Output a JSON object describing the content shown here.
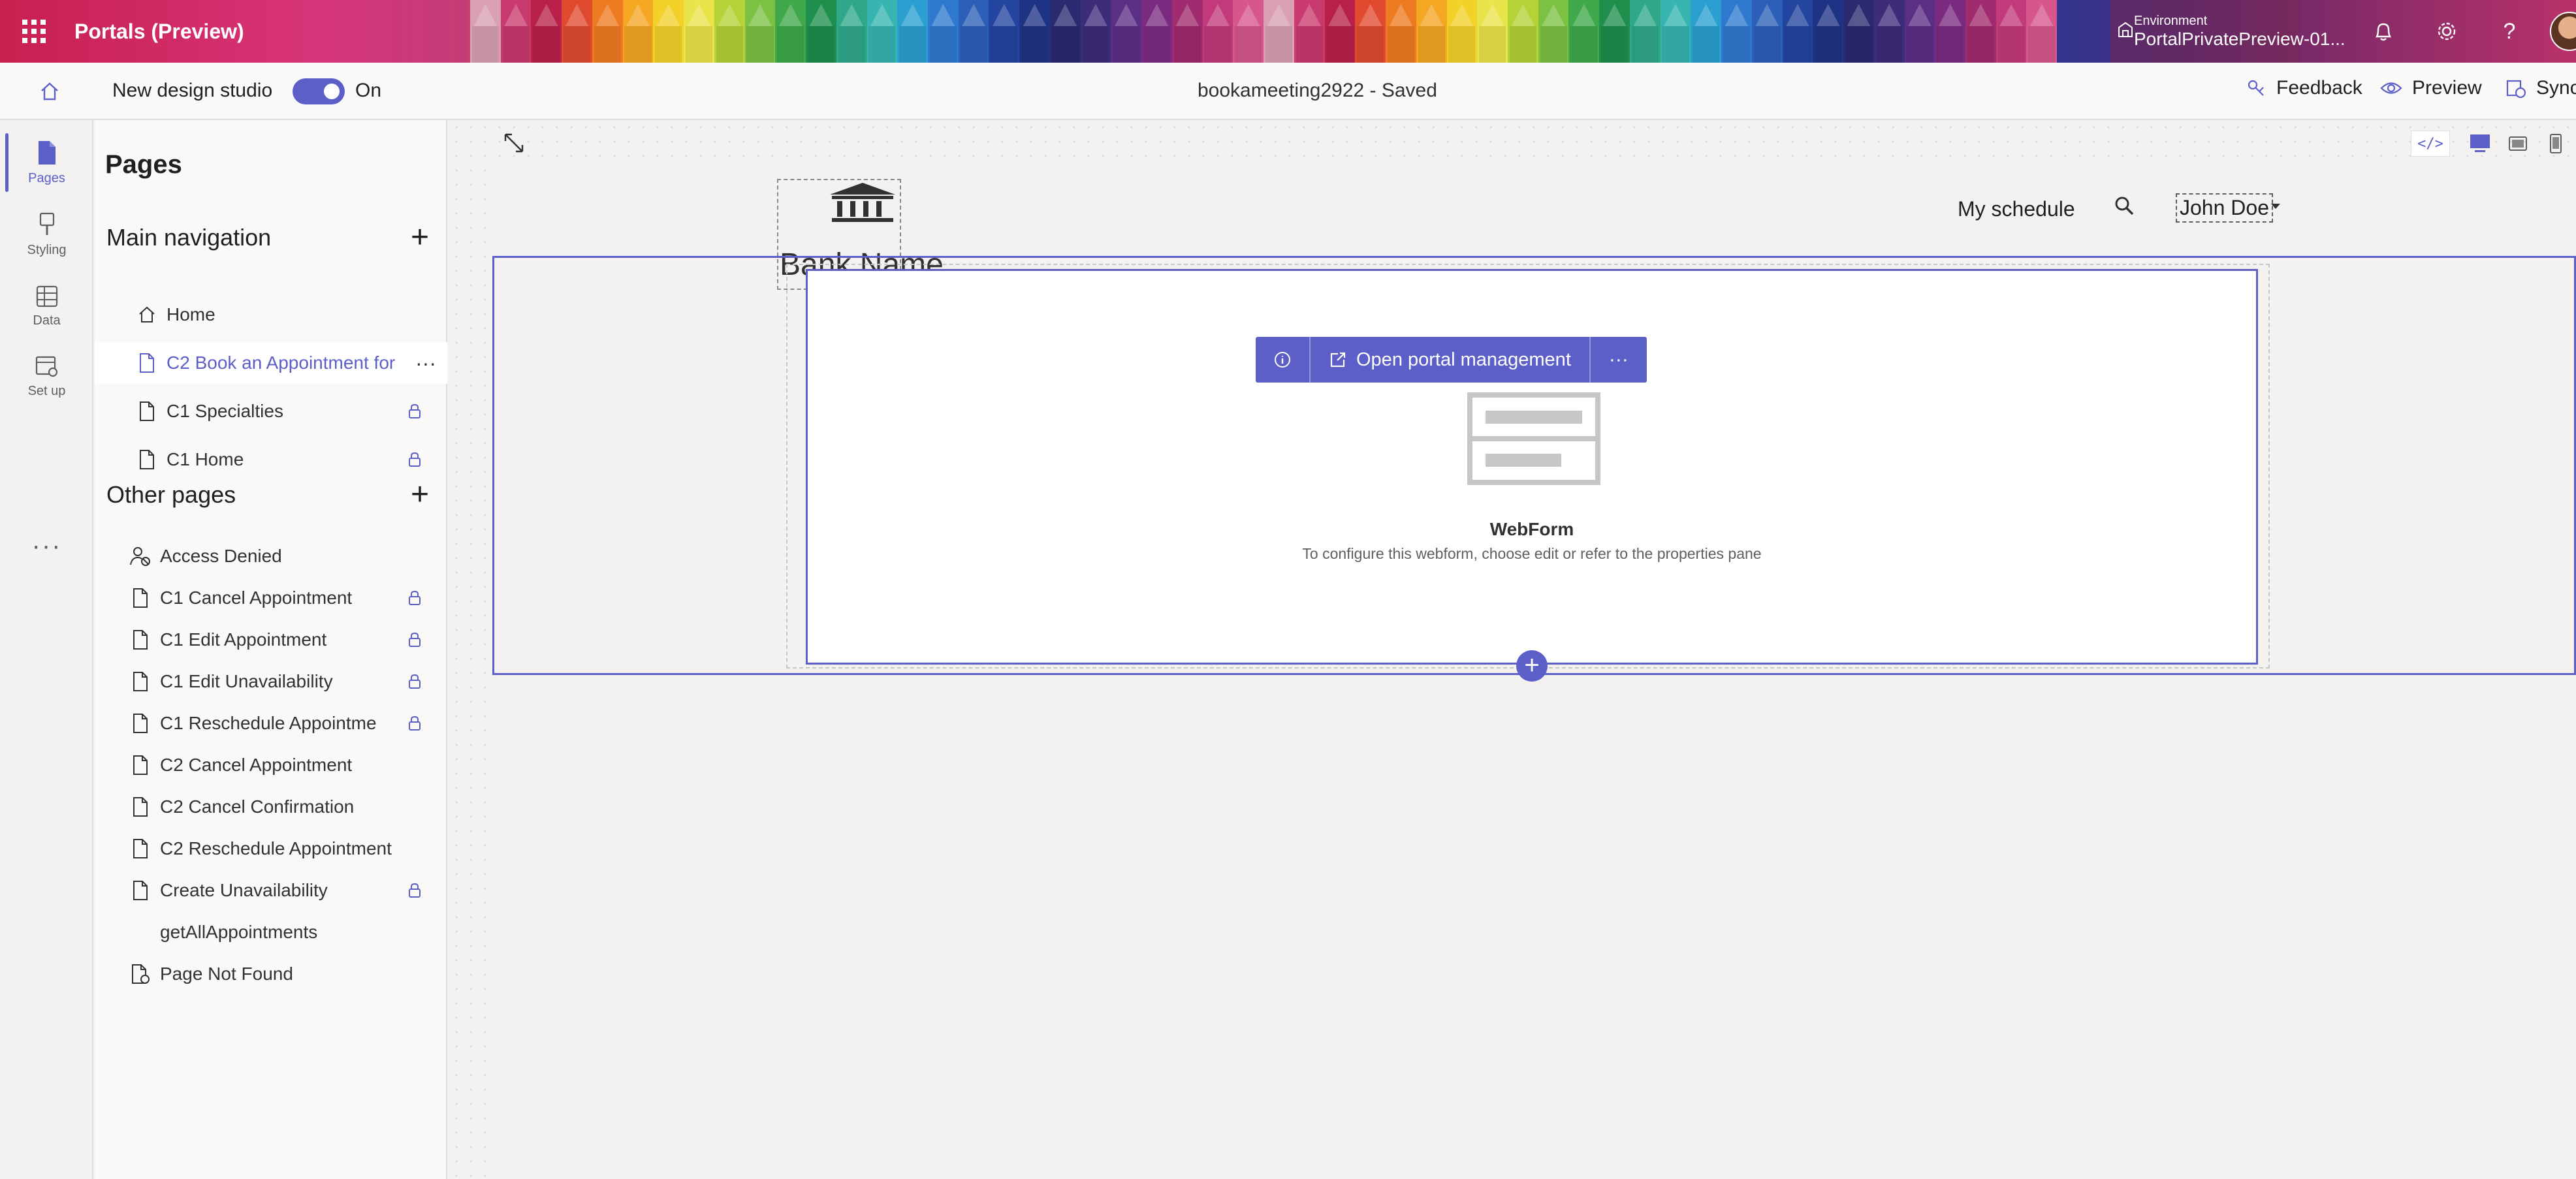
{
  "app": {
    "title": "Portals (Preview)"
  },
  "environment": {
    "label": "Environment",
    "name": "PortalPrivatePreview-01..."
  },
  "commandbar": {
    "design_studio_label": "New design studio",
    "toggle_state": "On",
    "site_title": "bookameeting2922 - Saved",
    "feedback_label": "Feedback",
    "preview_label": "Preview",
    "sync_label": "Sync"
  },
  "rail": {
    "pages": "Pages",
    "styling": "Styling",
    "data": "Data",
    "setup": "Set up",
    "more": "···"
  },
  "panel": {
    "title": "Pages",
    "main_nav_heading": "Main navigation",
    "other_pages_heading": "Other pages",
    "main_items": [
      {
        "label": "Home",
        "icon": "home-icon",
        "locked": false
      },
      {
        "label": "C2 Book an Appointment for",
        "icon": "page-icon",
        "locked": false,
        "selected": true
      },
      {
        "label": "C1 Specialties",
        "icon": "page-icon",
        "locked": true
      },
      {
        "label": "C1 Home",
        "icon": "page-icon",
        "locked": true
      }
    ],
    "other_items": [
      {
        "label": "Access Denied",
        "icon": "person-lock-icon",
        "locked": false
      },
      {
        "label": "C1 Cancel Appointment",
        "icon": "page-icon",
        "locked": true
      },
      {
        "label": "C1 Edit Appointment",
        "icon": "page-icon",
        "locked": true
      },
      {
        "label": "C1 Edit Unavailability",
        "icon": "page-icon",
        "locked": true
      },
      {
        "label": "C1 Reschedule Appointme",
        "icon": "page-icon",
        "locked": true
      },
      {
        "label": "C2 Cancel Appointment",
        "icon": "page-icon",
        "locked": false
      },
      {
        "label": "C2 Cancel Confirmation",
        "icon": "page-icon",
        "locked": false
      },
      {
        "label": "C2 Reschedule Appointment",
        "icon": "page-icon",
        "locked": false
      },
      {
        "label": "Create Unavailability",
        "icon": "page-icon",
        "locked": true
      },
      {
        "label": "getAllAppointments",
        "icon": "",
        "locked": false
      },
      {
        "label": "Page Not Found",
        "icon": "page-error-icon",
        "locked": false
      }
    ]
  },
  "canvas": {
    "code_label": "</>",
    "site": {
      "bank_name": "Bank Name",
      "nav_schedule": "My schedule",
      "user_name": "John Doe"
    },
    "toolbar": {
      "open_label": "Open portal management",
      "more_label": "···"
    },
    "webform": {
      "title": "WebForm",
      "subtitle": "To configure this webform, choose edit or refer to the properties pane"
    }
  },
  "colors": {
    "accent": "#5b5fc7",
    "banner": "#c21a5a"
  }
}
